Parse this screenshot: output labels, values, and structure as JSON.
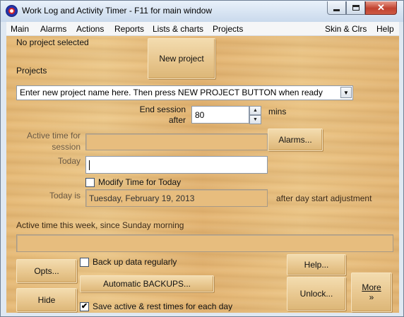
{
  "window": {
    "title": "Work Log and Activity Timer - F11 for main window",
    "close_glyph": "✕"
  },
  "menu": {
    "main": "Main",
    "alarms": "Alarms",
    "actions": "Actions",
    "reports": "Reports",
    "lists_charts": "Lists & charts",
    "projects": "Projects",
    "skin": "Skin & Clrs",
    "help": "Help"
  },
  "project": {
    "status": "No project selected",
    "projects_label": "Projects",
    "new_button": "New project",
    "combo_value": "Enter new project name here. Then press NEW PROJECT BUTTON when ready",
    "combo_arrow": "▼"
  },
  "session": {
    "end_label_1": "End session",
    "end_label_2": "after",
    "end_value": "80",
    "end_unit": "mins",
    "spin_up": "▲",
    "spin_down": "▼",
    "active_label_1": "Active time for",
    "active_label_2": "session",
    "active_value": "",
    "alarms_button": "Alarms..."
  },
  "today": {
    "label": "Today",
    "value": "",
    "modify_label": "Modify Time for Today",
    "modify_checked": false,
    "today_is_label": "Today is",
    "date_value": "Tuesday, February 19, 2013",
    "adjust_label": "after day start adjustment"
  },
  "week": {
    "label": "Active time this week, since Sunday morning",
    "value": ""
  },
  "bottom": {
    "opts_button": "Opts...",
    "hide_button": "Hide",
    "backup_label": "Back up data regularly",
    "backup_checked": false,
    "auto_backups_button": "Automatic BACKUPS...",
    "save_label": "Save active & rest times for each day",
    "save_checked": true,
    "check_mark": "✔",
    "help_button": "Help...",
    "unlock_button": "Unlock...",
    "more_button_1": "More",
    "more_button_2": "»"
  }
}
